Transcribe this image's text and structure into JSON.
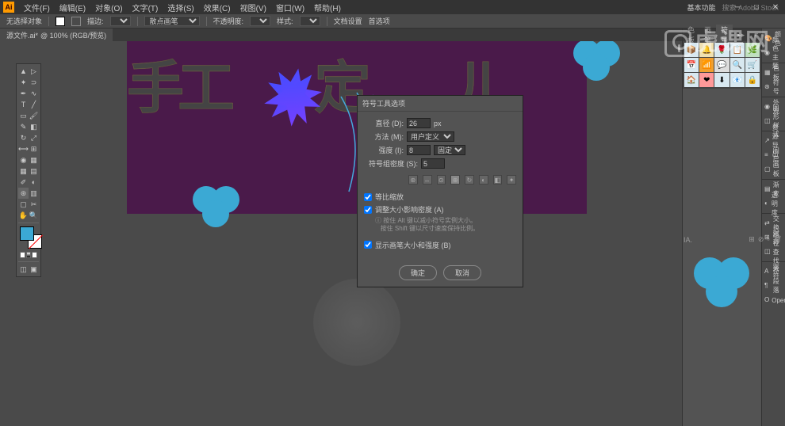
{
  "app": {
    "logo": "Ai"
  },
  "menu": {
    "items": [
      "文件(F)",
      "编辑(E)",
      "对象(O)",
      "文字(T)",
      "选择(S)",
      "效果(C)",
      "视图(V)",
      "窗口(W)",
      "帮助(H)"
    ]
  },
  "menubar_right": {
    "workspace": "基本功能",
    "search": "搜索 Adobe Stock"
  },
  "controlbar": {
    "nofill": "无选择对象",
    "brush_label": "描边:",
    "brush_dropdown": "散点画笔",
    "opacity_label": "不透明度:",
    "style_label": "样式:",
    "docsetup": "文档设置",
    "prefs": "首选项"
  },
  "tab": {
    "filename": "源文件.ai*",
    "zoom": "@ 100% (RGB/预览)"
  },
  "dialog": {
    "title": "符号工具选项",
    "diameter_label": "直径 (D):",
    "diameter_value": "26",
    "diameter_unit": "px",
    "method_label": "方法 (M):",
    "method_value": "用户定义",
    "intensity_label": "强度 (I):",
    "intensity_value": "8",
    "intensity_mode": "固定",
    "density_label": "符号组密度 (S):",
    "density_value": "5",
    "check1": "等比缩放",
    "check2": "调整大小影响密度 (A)",
    "info1": "按住 Alt 键以减小符号实例大小。",
    "info2": "按住 Shift 键以尺寸速度保持比例。",
    "check3": "显示画笔大小和强度 (B)",
    "ok": "确定",
    "cancel": "取消"
  },
  "panels": {
    "tabs": [
      "色板",
      "画笔",
      "符号"
    ],
    "active_tab": "符号",
    "strip": [
      "颜色",
      "颜色主题",
      "色板",
      "符号",
      "外观",
      "图形样式",
      "资源导出",
      "图层",
      "画板",
      "渐变",
      "透明度",
      "交换",
      "对齐",
      "路径查找器",
      "字符",
      "段落",
      "OpenType"
    ]
  },
  "watermark": "虎课网",
  "symbols": {
    "colors": [
      "#d84",
      "#5bd",
      "#8c5",
      "#c58",
      "#5c8",
      "#c85",
      "#58c",
      "#aaa",
      "#48c",
      "#c48",
      "#4c8",
      "#84c",
      "#c84",
      "#8c4",
      "#48c"
    ]
  }
}
